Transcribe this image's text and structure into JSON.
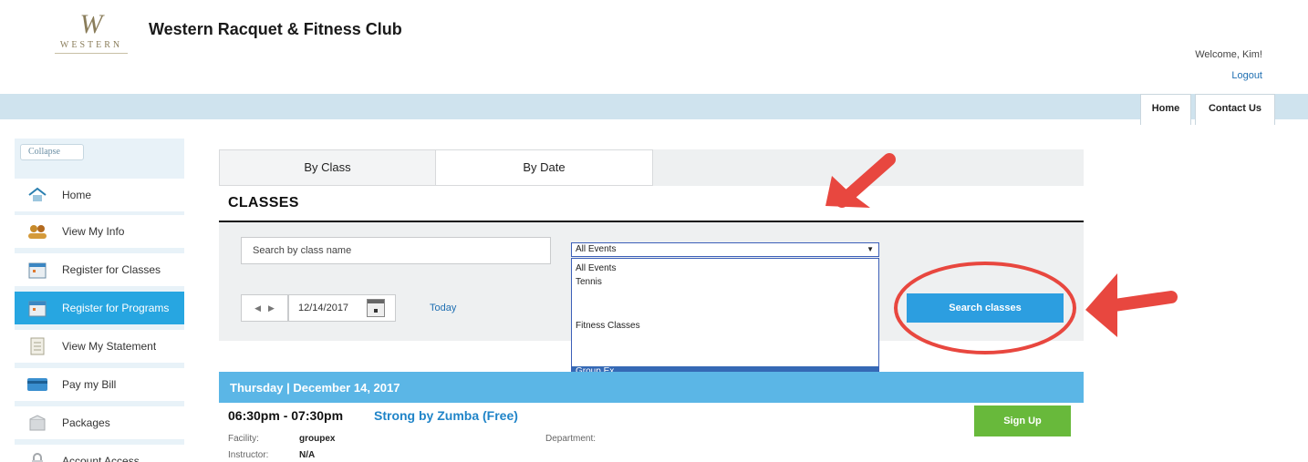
{
  "header": {
    "logo_letter": "W",
    "logo_word": "WESTERN",
    "site_title": "Western Racquet & Fitness Club",
    "welcome": "Welcome, Kim!",
    "logout": "Logout"
  },
  "top_nav": {
    "home": "Home",
    "contact": "Contact Us"
  },
  "sidebar": {
    "collapse": "Collapse",
    "items": [
      {
        "label": "Home",
        "icon": "home-icon",
        "active": false
      },
      {
        "label": "View My Info",
        "icon": "people-icon",
        "active": false
      },
      {
        "label": "Register for Classes",
        "icon": "calendar-icon",
        "active": false
      },
      {
        "label": "Register for Programs",
        "icon": "calendar-icon",
        "active": true
      },
      {
        "label": "View My Statement",
        "icon": "document-icon",
        "active": false
      },
      {
        "label": "Pay my Bill",
        "icon": "card-icon",
        "active": false
      },
      {
        "label": "Packages",
        "icon": "package-icon",
        "active": false
      },
      {
        "label": "Account Access",
        "icon": "lock-icon",
        "active": false
      }
    ]
  },
  "tabs": {
    "by_class": "By Class",
    "by_date": "By Date"
  },
  "main": {
    "title": "CLASSES",
    "search_placeholder": "Search by class name",
    "select_value": "All Events",
    "options": [
      "All Events",
      "Tennis",
      "Fitness Classes",
      "Group Ex"
    ],
    "selected_option": "Group Ex",
    "date_value": "12/14/2017",
    "today": "Today",
    "search_button": "Search classes"
  },
  "results": {
    "date_header": "Thursday | December 14, 2017",
    "time": "06:30pm - 07:30pm",
    "class_name": "Strong by Zumba (Free)",
    "signup": "Sign Up",
    "facility_label": "Facility:",
    "facility_value": "groupex",
    "department_label": "Department:",
    "instructor_label": "Instructor:",
    "instructor_value": "N/A"
  },
  "colors": {
    "accent_blue": "#27a6e1",
    "top_bar": "#cfe3ee",
    "signup_green": "#68b93b",
    "annotation_red": "#e8473f"
  }
}
